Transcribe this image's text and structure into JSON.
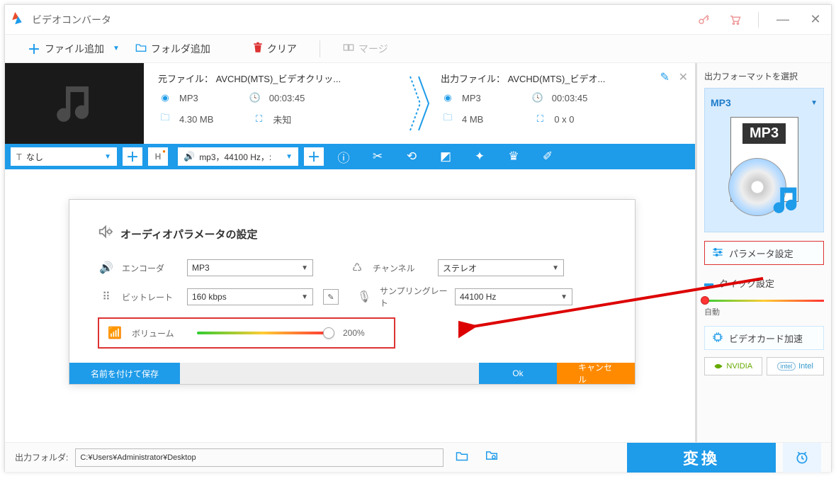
{
  "app_title": "ビデオコンバータ",
  "toolbar": {
    "add_file": "ファイル追加",
    "add_folder": "フォルダ追加",
    "clear": "クリア",
    "merge": "マージ"
  },
  "file": {
    "source_label": "元ファイル：",
    "source_name": "AVCHD(MTS)_ビデオクリッ...",
    "output_label": "出力ファイル：",
    "output_name": "AVCHD(MTS)_ビデオ...",
    "src_format": "MP3",
    "src_duration": "00:03:45",
    "src_size": "4.30 MB",
    "src_res": "未知",
    "out_format": "MP3",
    "out_duration": "00:03:45",
    "out_size": "4 MB",
    "out_res": "0 x 0"
  },
  "bluebar": {
    "subtitle_select": "なし",
    "audio_select": "mp3，44100 Hz，:"
  },
  "dialog": {
    "title": "オーディオパラメータの設定",
    "encoder_label": "エンコーダ",
    "encoder_value": "MP3",
    "channel_label": "チャンネル",
    "channel_value": "ステレオ",
    "bitrate_label": "ビットレート",
    "bitrate_value": "160 kbps",
    "samplerate_label": "サンプリングレート",
    "samplerate_value": "44100 Hz",
    "volume_label": "ボリューム",
    "volume_value": "200%",
    "save_as": "名前を付けて保存",
    "ok": "Ok",
    "cancel": "キャンセル"
  },
  "right": {
    "heading": "出力フォーマットを選択",
    "format": "MP3",
    "format_badge": "MP3",
    "param_btn": "パラメータ設定",
    "quick_btn": "クイック設定",
    "auto": "自動",
    "gpu_btn": "ビデオカード加速",
    "nvidia": "NVIDIA",
    "intel": "Intel"
  },
  "footer": {
    "label": "出力フォルダ:",
    "path": "C:¥Users¥Administrator¥Desktop",
    "convert": "変換"
  }
}
